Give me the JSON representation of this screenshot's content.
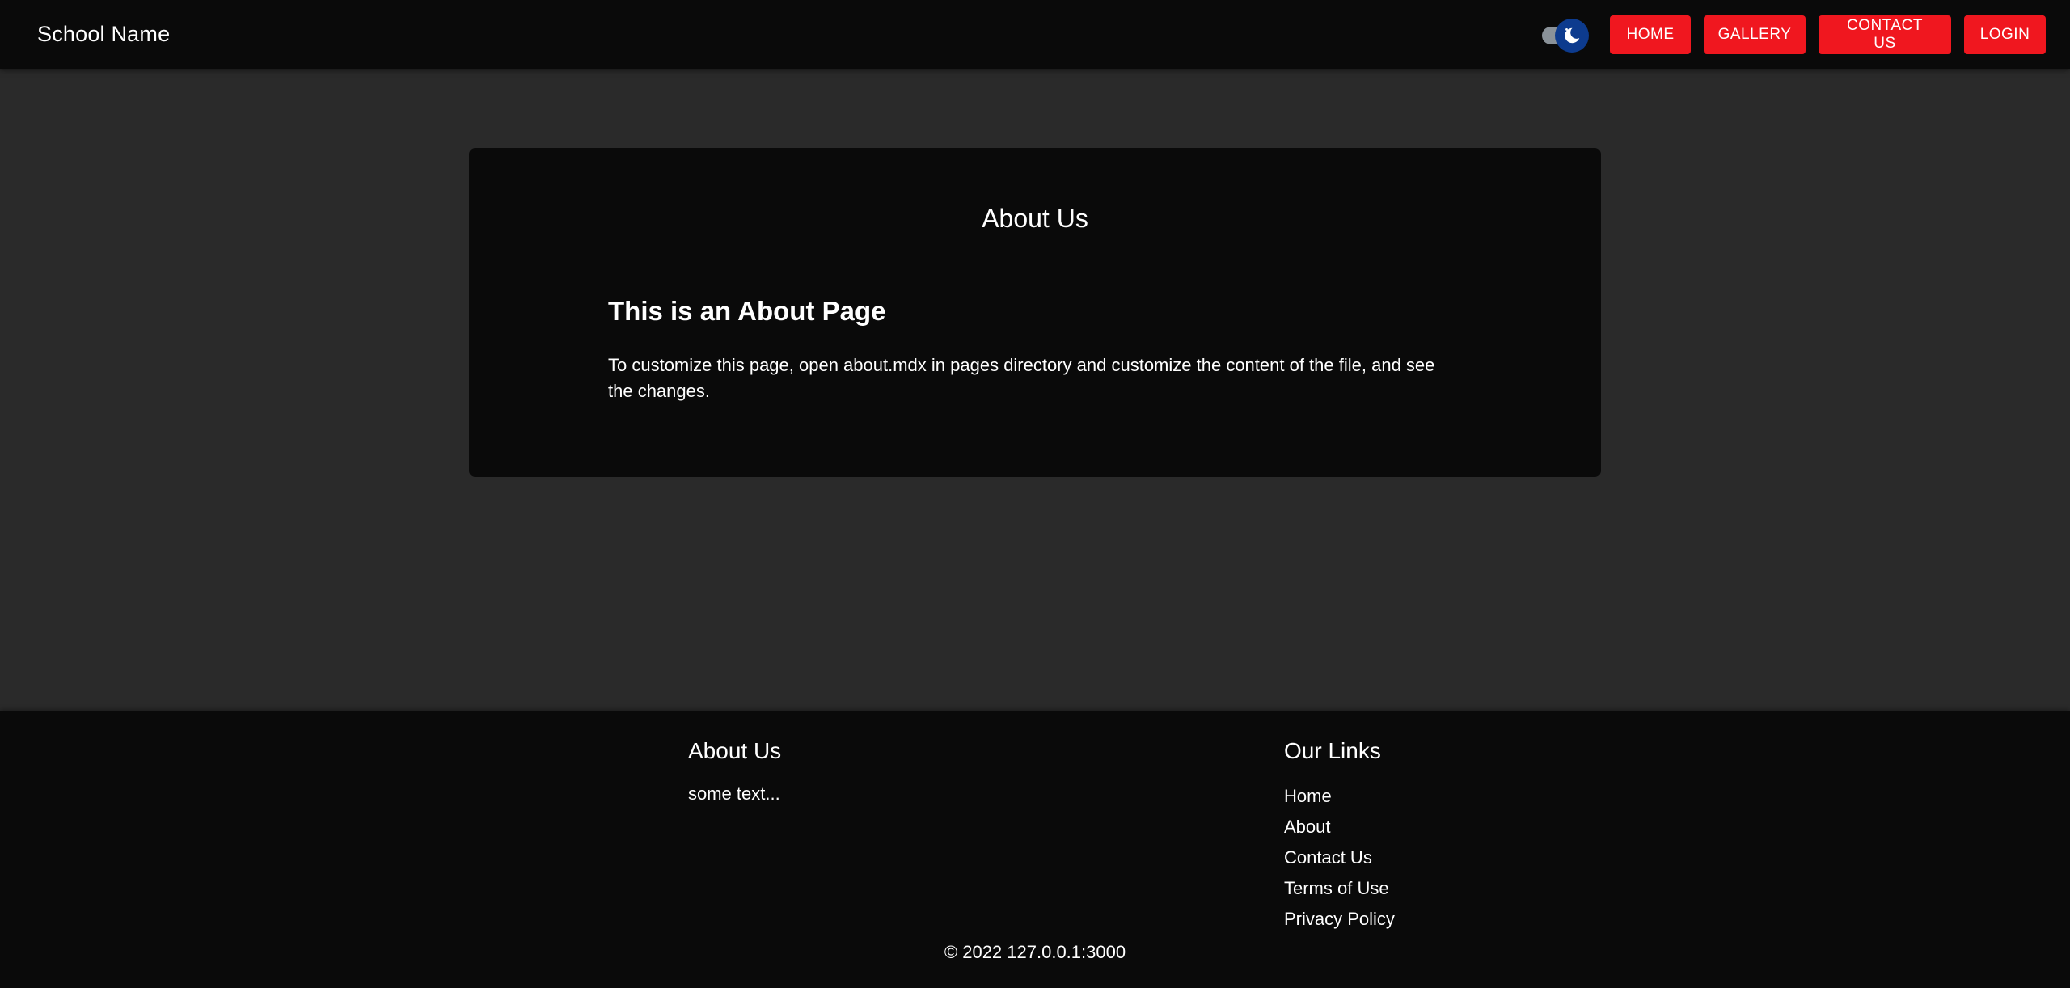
{
  "header": {
    "brand": "School Name",
    "theme_toggle_icon": "moon-icon",
    "nav": {
      "home": "HOME",
      "gallery": "GALLERY",
      "contact": "CONTACT US",
      "login": "LOGIN"
    }
  },
  "main": {
    "title": "About Us",
    "heading": "This is an About Page",
    "body": "To customize this page, open about.mdx in pages directory and customize the content of the file, and see the changes."
  },
  "footer": {
    "about": {
      "title": "About Us",
      "text": "some text..."
    },
    "links": {
      "title": "Our Links",
      "items": [
        "Home",
        "About",
        "Contact Us",
        "Terms of Use",
        "Privacy Policy"
      ]
    },
    "copyright": "© 2022 127.0.0.1:3000"
  },
  "colors": {
    "accent": "#f0171f",
    "toggle_thumb": "#0d3b8e",
    "surface": "#0a0a0a",
    "background": "#2a2a2a"
  }
}
